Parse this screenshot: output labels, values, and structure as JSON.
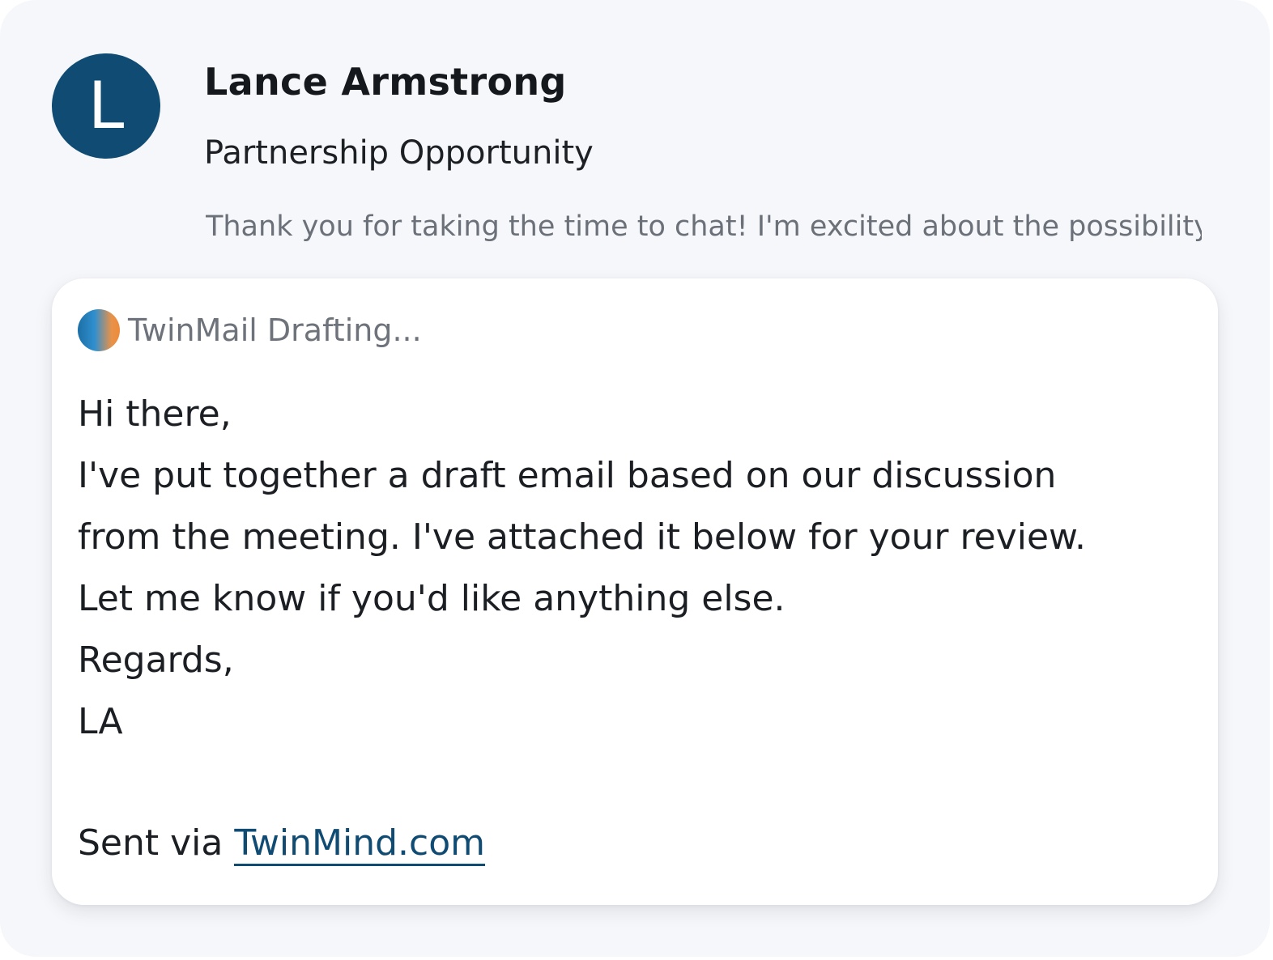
{
  "sender": {
    "initial": "L",
    "name": "Lance Armstrong"
  },
  "email": {
    "subject": "Partnership Opportunity",
    "snippet": "Thank you for taking the time to chat! I'm excited about the possibility..."
  },
  "draft": {
    "status": "TwinMail Drafting...",
    "lines": [
      "Hi there,",
      "I've put together a draft email based on our discussion",
      "from the meeting. I've attached it below for your review.",
      "Let me know if you'd like anything else.",
      "Regards,",
      "LA"
    ],
    "footer_prefix": "Sent via ",
    "footer_link": "TwinMind.com"
  },
  "colors": {
    "avatar_bg": "#0f4b72",
    "link": "#0f4b72",
    "background": "#f6f7fa"
  },
  "icons": {
    "status": "gradient-dot-icon"
  }
}
